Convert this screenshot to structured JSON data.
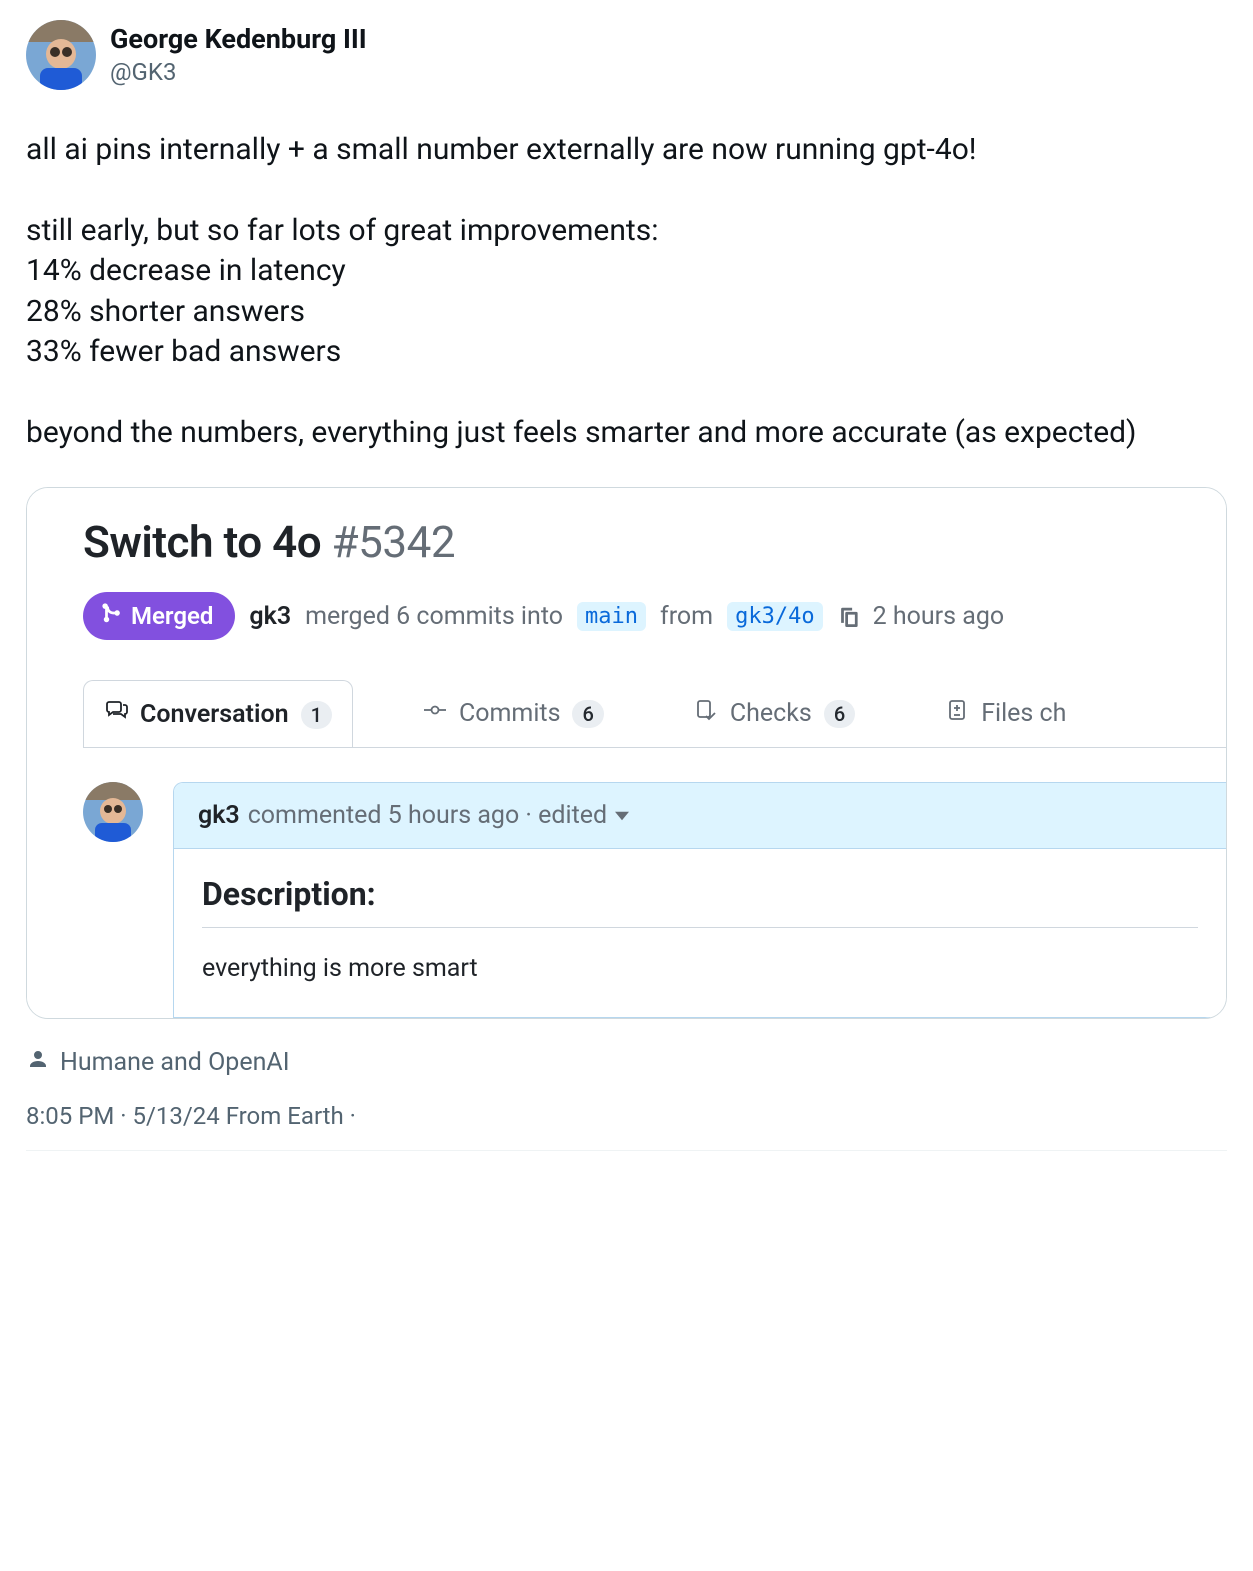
{
  "tweet": {
    "author": {
      "display_name": "George Kedenburg III",
      "handle": "@GK3"
    },
    "body_lines": [
      "all ai pins internally + a small number externally are now running gpt-4o!",
      "",
      "still early, but so far lots of great improvements:",
      "14% decrease in latency",
      "28% shorter answers",
      "33% fewer bad answers",
      "",
      "beyond the numbers, everything just feels smarter and more accurate (as expected)"
    ],
    "alt_text": "Humane and OpenAI",
    "timestamp": "8:05 PM · 5/13/24 From Earth ·"
  },
  "pr": {
    "title": "Switch to 4o",
    "number": "#5342",
    "badge": "Merged",
    "meta": {
      "author": "gk3",
      "merged_text_1": "merged 6 commits into",
      "base_branch": "main",
      "from_label": "from",
      "head_branch": "gk3/4o",
      "time_ago": "2 hours ago"
    },
    "tabs": {
      "conversation": {
        "label": "Conversation",
        "count": "1"
      },
      "commits": {
        "label": "Commits",
        "count": "6"
      },
      "checks": {
        "label": "Checks",
        "count": "6"
      },
      "files": {
        "label": "Files ch"
      }
    },
    "comment": {
      "author": "gk3",
      "meta": "commented 5 hours ago · edited",
      "heading": "Description:",
      "body": "everything is more smart"
    }
  }
}
